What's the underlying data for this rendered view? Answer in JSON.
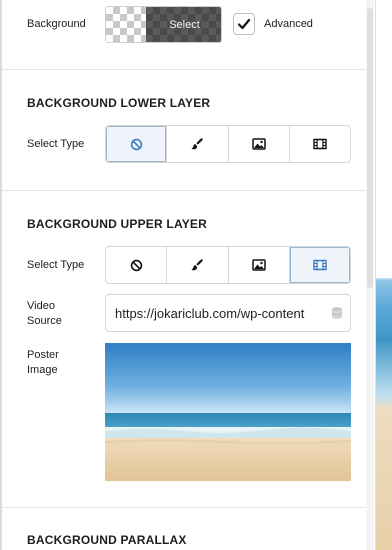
{
  "top": {
    "background_label": "Background",
    "picker_label": "Select",
    "advanced_label": "Advanced",
    "advanced_checked": true
  },
  "lower_layer": {
    "title": "BACKGROUND LOWER LAYER",
    "select_type_label": "Select Type",
    "options": [
      "none-icon",
      "paint-brush-icon",
      "image-icon",
      "video-icon"
    ],
    "selected": "none"
  },
  "upper_layer": {
    "title": "BACKGROUND UPPER LAYER",
    "select_type_label": "Select Type",
    "options": [
      "none-icon",
      "paint-brush-icon",
      "image-icon",
      "video-icon"
    ],
    "selected": "video",
    "video_source_label": "Video Source",
    "video_source_value": "https://jokariclub.com/wp-content",
    "poster_image_label": "Poster Image"
  },
  "parallax": {
    "title": "BACKGROUND PARALLAX"
  },
  "colors": {
    "accent": "#3b7bbf",
    "active_segment_bg": "#eef4fa",
    "icon": "#1e1e1e"
  }
}
